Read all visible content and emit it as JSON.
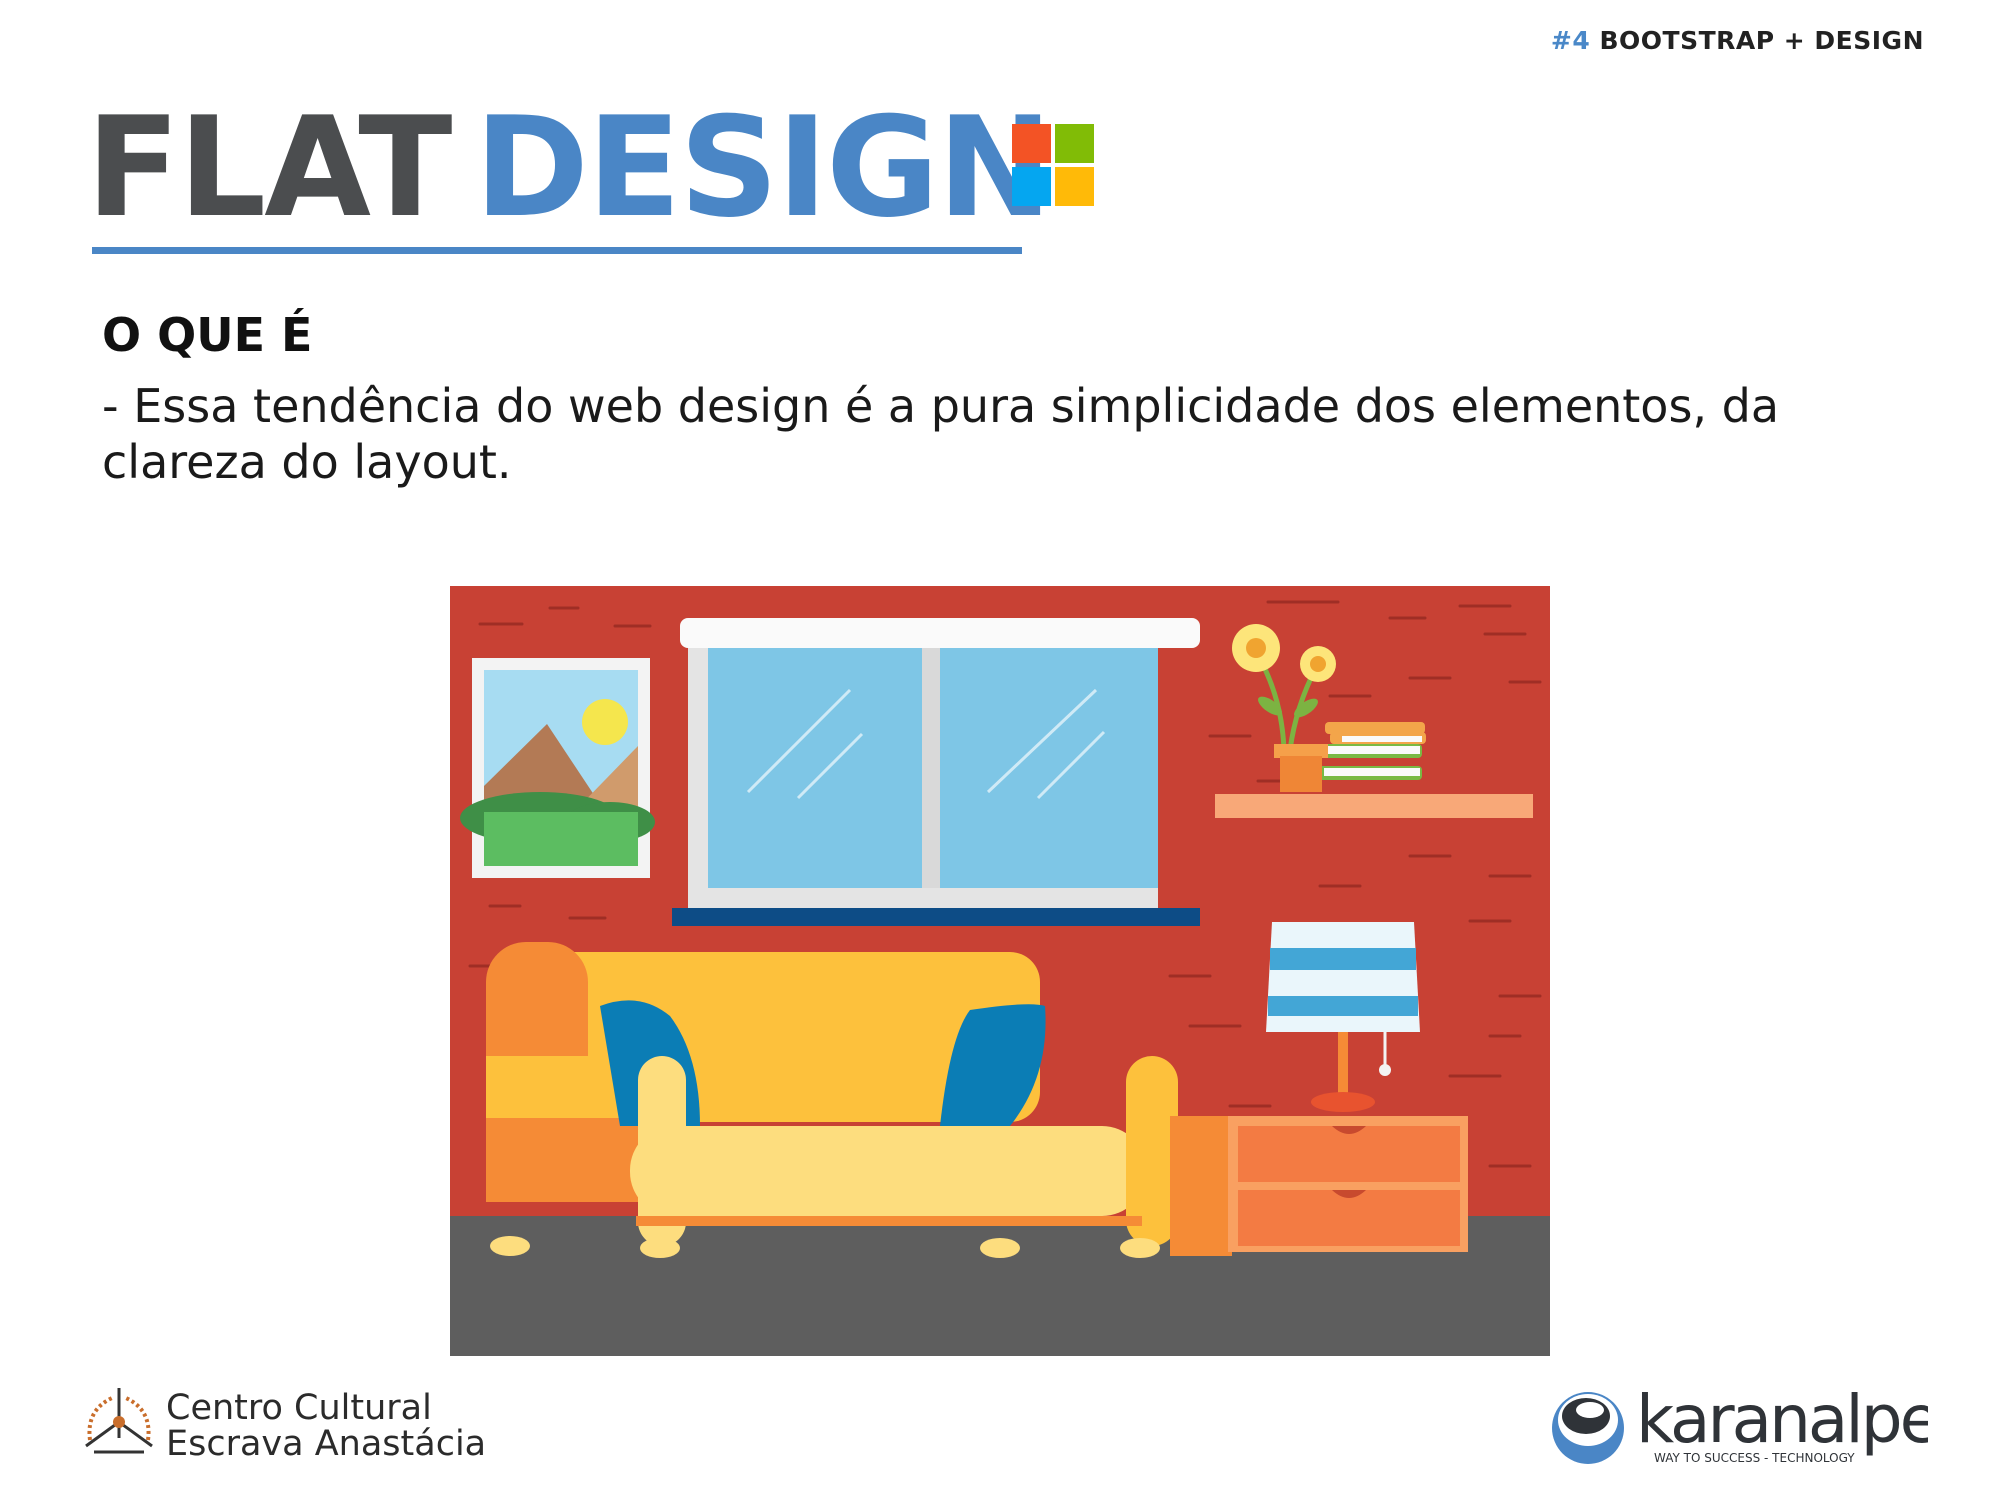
{
  "header": {
    "series_number": "#4",
    "series_title": "BOOTSTRAP + DESIGN"
  },
  "slide": {
    "title_word1": "FLAT",
    "title_word2": "DESIGN",
    "section_heading": "O QUE É",
    "body_line1": "- Essa tendência do web design é a pura simplicidade dos elementos, da",
    "body_line2": "clareza do layout."
  },
  "footer": {
    "left_logo_line1": "Centro Cultural",
    "left_logo_line2": "Escrava Anastácia",
    "right_logo_name": "karanalpe",
    "right_logo_tagline": "WAY TO SUCCESS - TECHNOLOGY"
  },
  "colors": {
    "title_dark": "#4b4d4f",
    "title_blue": "#4a86c6",
    "ms_red": "#f35325",
    "ms_green": "#81bc06",
    "ms_blue": "#05a6f0",
    "ms_yellow": "#ffba08",
    "wall_red": "#c84134",
    "floor_gray": "#5e5e5e"
  },
  "icons": {
    "title_logo": "windows-logo-icon",
    "illustration": "flat-living-room-illustration"
  }
}
